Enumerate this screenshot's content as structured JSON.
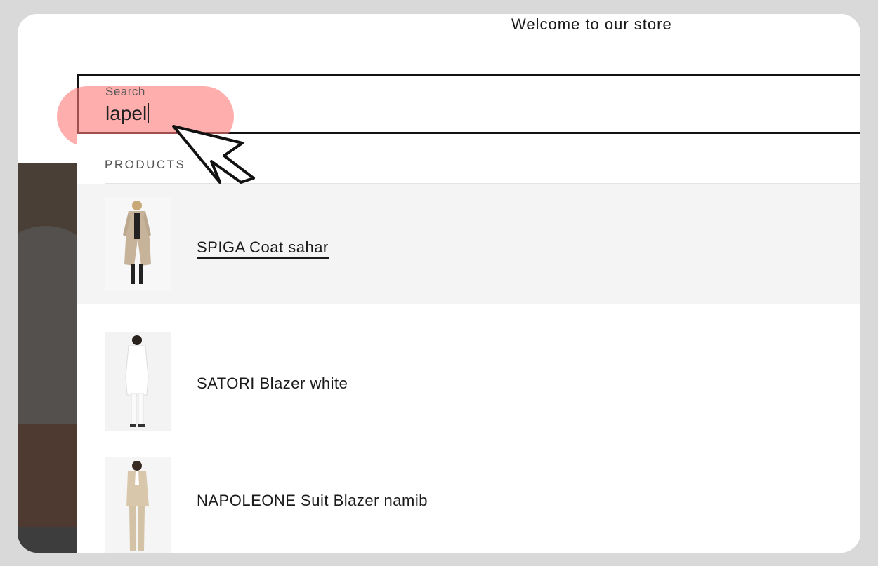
{
  "announcement": {
    "text": "Welcome to our store"
  },
  "search": {
    "label": "Search",
    "value": "lapel"
  },
  "results": {
    "section_heading": "PRODUCTS",
    "products": [
      {
        "name": "SPIGA Coat sahar",
        "active": true
      },
      {
        "name": "SATORI Blazer white",
        "active": false
      },
      {
        "name": "NAPOLEONE Suit Blazer namib",
        "active": false
      }
    ]
  },
  "colors": {
    "highlight": "#ff7878",
    "text": "#1a1a1a",
    "active_row": "#f4f4f4"
  },
  "icons": {
    "pointer": "mouse-pointer-icon"
  }
}
